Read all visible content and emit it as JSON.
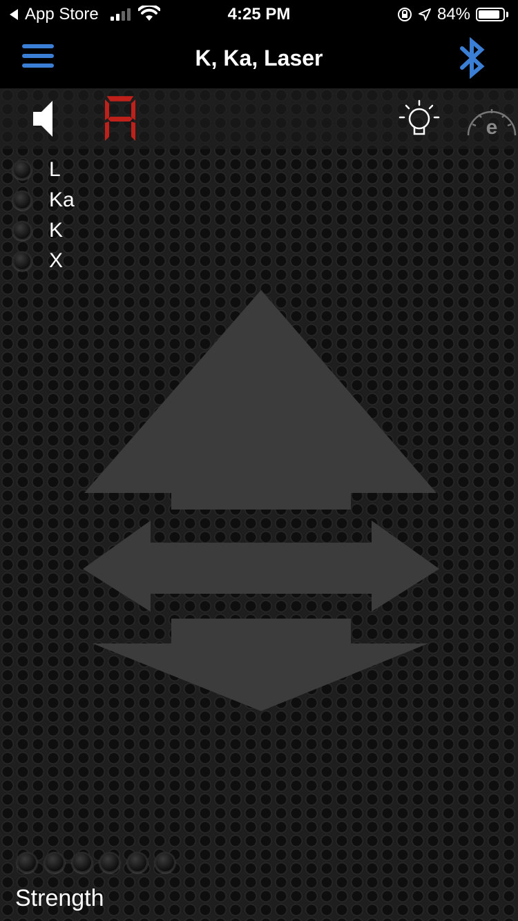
{
  "status_bar": {
    "back_app": "App Store",
    "time": "4:25 PM",
    "battery": "84%"
  },
  "nav": {
    "title": "K, Ka, Laser"
  },
  "display": {
    "digit_color": "#c0201a"
  },
  "bands": [
    {
      "label": "L"
    },
    {
      "label": "Ka"
    },
    {
      "label": "K"
    },
    {
      "label": "X"
    }
  ],
  "gauge_letter": "e",
  "strength": {
    "label": "Strength",
    "leds": 6
  },
  "colors": {
    "accent": "#3a7fd5",
    "arrow": "#3c3c3c"
  }
}
